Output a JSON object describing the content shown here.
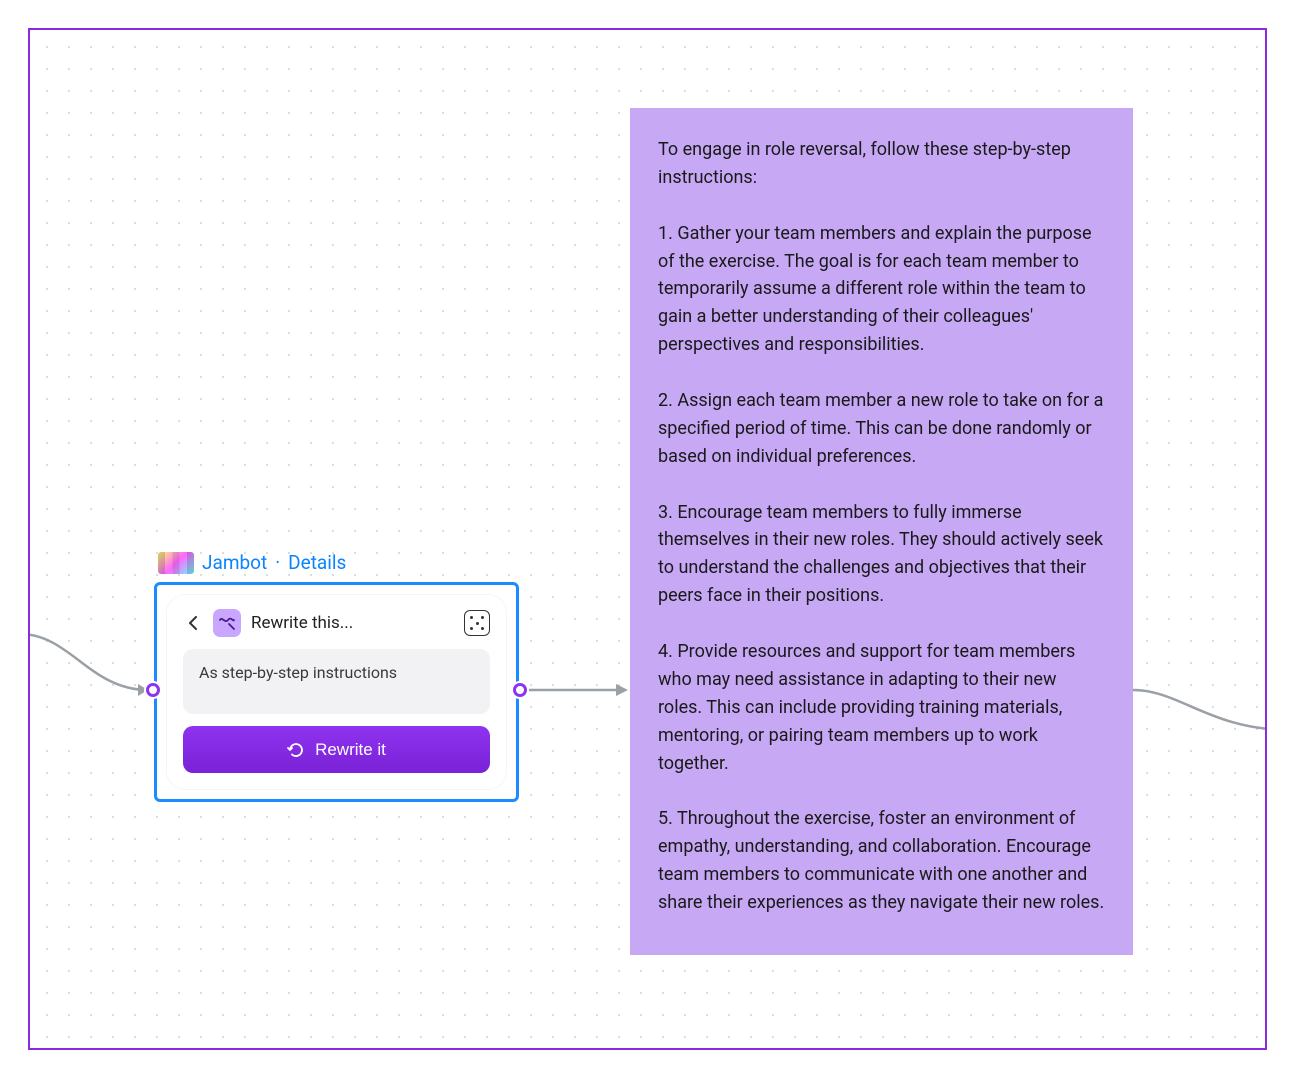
{
  "colors": {
    "frame_border": "#8a2be2",
    "selection_blue": "#1a8cff",
    "link_blue": "#0a84ff",
    "button_purple": "#8e33f0",
    "sticky_bg": "#c7a8f5"
  },
  "widget": {
    "app_name": "Jambot",
    "details_link": "Details",
    "title": "Rewrite this...",
    "prompt_value": "As step-by-step instructions",
    "button_label": "Rewrite it"
  },
  "output": {
    "intro": "To engage in role reversal, follow these step-by-step instructions:",
    "step1": "1. Gather your team members and explain the purpose of the exercise. The goal is for each team member to temporarily assume a different role within the team to gain a better understanding of their colleagues' perspectives and responsibilities.",
    "step2": "2. Assign each team member a new role to take on for a specified period of time. This can be done randomly or based on individual preferences.",
    "step3": "3. Encourage team members to fully immerse themselves in their new roles. They should actively seek to understand the challenges and objectives that their peers face in their positions.",
    "step4": "4. Provide resources and support for team members who may need assistance in adapting to their new roles. This can include providing training materials, mentoring, or pairing team members up to work together.",
    "step5": "5. Throughout the exercise, foster an environment of empathy, understanding, and collaboration. Encourage team members to communicate with one another and share their experiences as they navigate their new roles."
  }
}
